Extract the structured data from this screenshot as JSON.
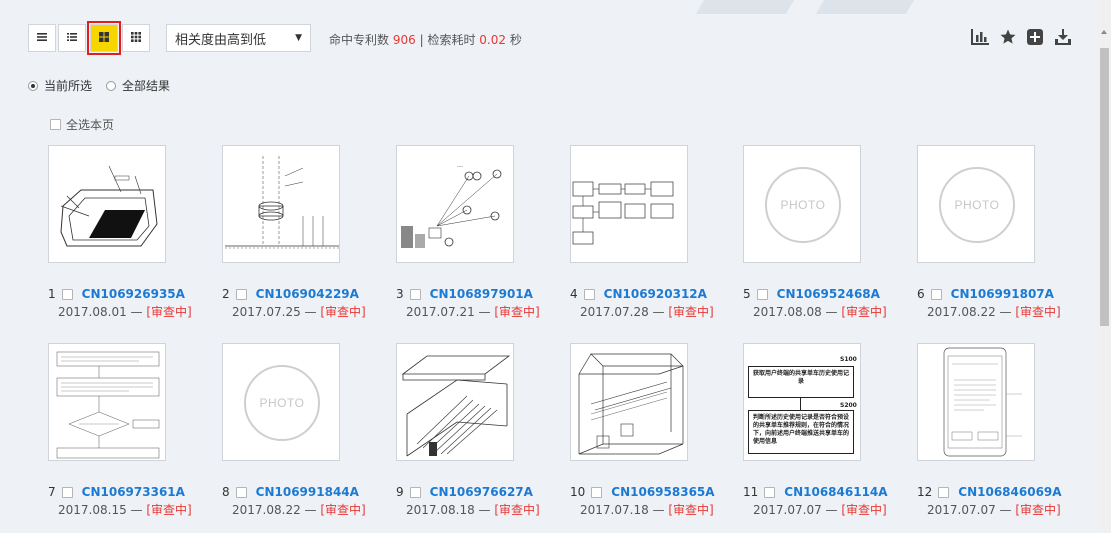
{
  "toolbar": {
    "view_modes": [
      "list-detail-icon",
      "list-compact-icon",
      "grid-large-icon",
      "grid-small-icon"
    ],
    "active_view": "grid-large-icon",
    "sort": {
      "selected": "相关度由高到低"
    },
    "stats": {
      "hit_label": "命中专利数",
      "hit_count": "906",
      "sep": "|",
      "time_label": "检索耗时",
      "time_value": "0.02",
      "time_unit": "秒"
    },
    "tools": [
      "chart-icon",
      "star-icon",
      "add-icon",
      "download-icon"
    ]
  },
  "scope": {
    "current": "当前所选",
    "all": "全部结果",
    "selected": "current"
  },
  "select_all_label": "全选本页",
  "colors": {
    "accent_blue": "#1c7ad3",
    "status_red": "#e53935",
    "active_yellow": "#f7d600"
  },
  "results": [
    {
      "idx": "1",
      "pn": "CN106926935A",
      "date": "2017.08.01",
      "sep": "—",
      "status": "[审查中]",
      "thumb": "drawing-tray"
    },
    {
      "idx": "2",
      "pn": "CN106904229A",
      "date": "2017.07.25",
      "sep": "—",
      "status": "[审查中]",
      "thumb": "drawing-pole"
    },
    {
      "idx": "3",
      "pn": "CN106897901A",
      "date": "2017.07.21",
      "sep": "—",
      "status": "[审查中]",
      "thumb": "drawing-bikes"
    },
    {
      "idx": "4",
      "pn": "CN106920312A",
      "date": "2017.07.28",
      "sep": "—",
      "status": "[审查中]",
      "thumb": "drawing-blocks"
    },
    {
      "idx": "5",
      "pn": "CN106952468A",
      "date": "2017.08.08",
      "sep": "—",
      "status": "[审查中]",
      "thumb": "photo",
      "placeholder": "PHOTO"
    },
    {
      "idx": "6",
      "pn": "CN106991807A",
      "date": "2017.08.22",
      "sep": "—",
      "status": "[审查中]",
      "thumb": "photo",
      "placeholder": "PHOTO"
    },
    {
      "idx": "7",
      "pn": "CN106973361A",
      "date": "2017.08.15",
      "sep": "—",
      "status": "[审查中]",
      "thumb": "drawing-flow"
    },
    {
      "idx": "8",
      "pn": "CN106991844A",
      "date": "2017.08.22",
      "sep": "—",
      "status": "[审查中]",
      "thumb": "photo",
      "placeholder": "PHOTO"
    },
    {
      "idx": "9",
      "pn": "CN106976627A",
      "date": "2017.08.18",
      "sep": "—",
      "status": "[审查中]",
      "thumb": "drawing-stairs"
    },
    {
      "idx": "10",
      "pn": "CN106958365A",
      "date": "2017.07.18",
      "sep": "—",
      "status": "[审查中]",
      "thumb": "drawing-box"
    },
    {
      "idx": "11",
      "pn": "CN106846114A",
      "date": "2017.07.07",
      "sep": "—",
      "status": "[审查中]",
      "thumb": "drawing-steps",
      "steps": [
        {
          "label": "S100",
          "text": "获取用户终端的共享单车历史使用记录"
        },
        {
          "label": "S200",
          "text": "判断所述历史使用记录是否符合预设的共享单车推荐规则，在符合的情况下，向前述用户终端推送共享单车的使用信息"
        }
      ]
    },
    {
      "idx": "12",
      "pn": "CN106846069A",
      "date": "2017.07.07",
      "sep": "—",
      "status": "[审查中]",
      "thumb": "drawing-phone"
    }
  ]
}
